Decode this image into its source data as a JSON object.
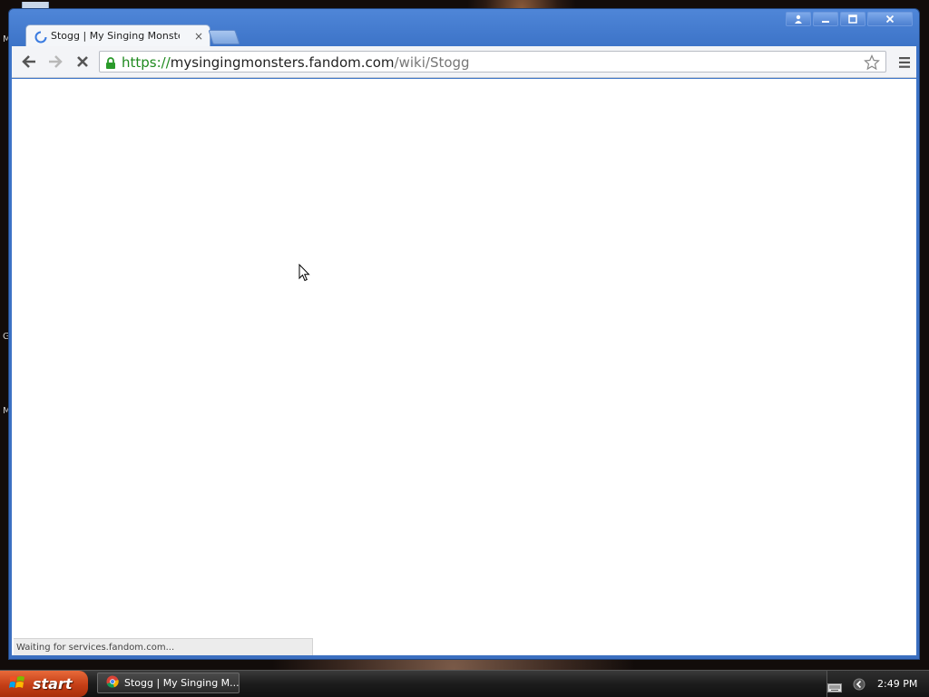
{
  "desktop": {
    "side_letters": [
      "M",
      "G",
      "M"
    ]
  },
  "browser": {
    "tab": {
      "title": "Stogg | My Singing Monsters",
      "close_glyph": "×"
    },
    "address_bar": {
      "scheme": "https://",
      "domain": "mysingingmonsters.fandom.com",
      "path": "/wiki/Stogg",
      "secure": true
    },
    "window_controls": [
      "user-icon",
      "minimize-icon",
      "maximize-icon",
      "close-icon"
    ],
    "toolbar_icons": [
      "back-arrow-icon",
      "forward-arrow-icon",
      "stop-icon",
      "lock-icon",
      "star-icon",
      "menu-icon"
    ],
    "status": "Waiting for services.fandom.com..."
  },
  "taskbar": {
    "start_label": "start",
    "task_item_label": "Stogg | My Singing M...",
    "clock": "2:49 PM"
  },
  "colors": {
    "window_frame": "#3d74c8",
    "secure_green": "#1f8a1f",
    "start_orange": "#c43e16"
  }
}
